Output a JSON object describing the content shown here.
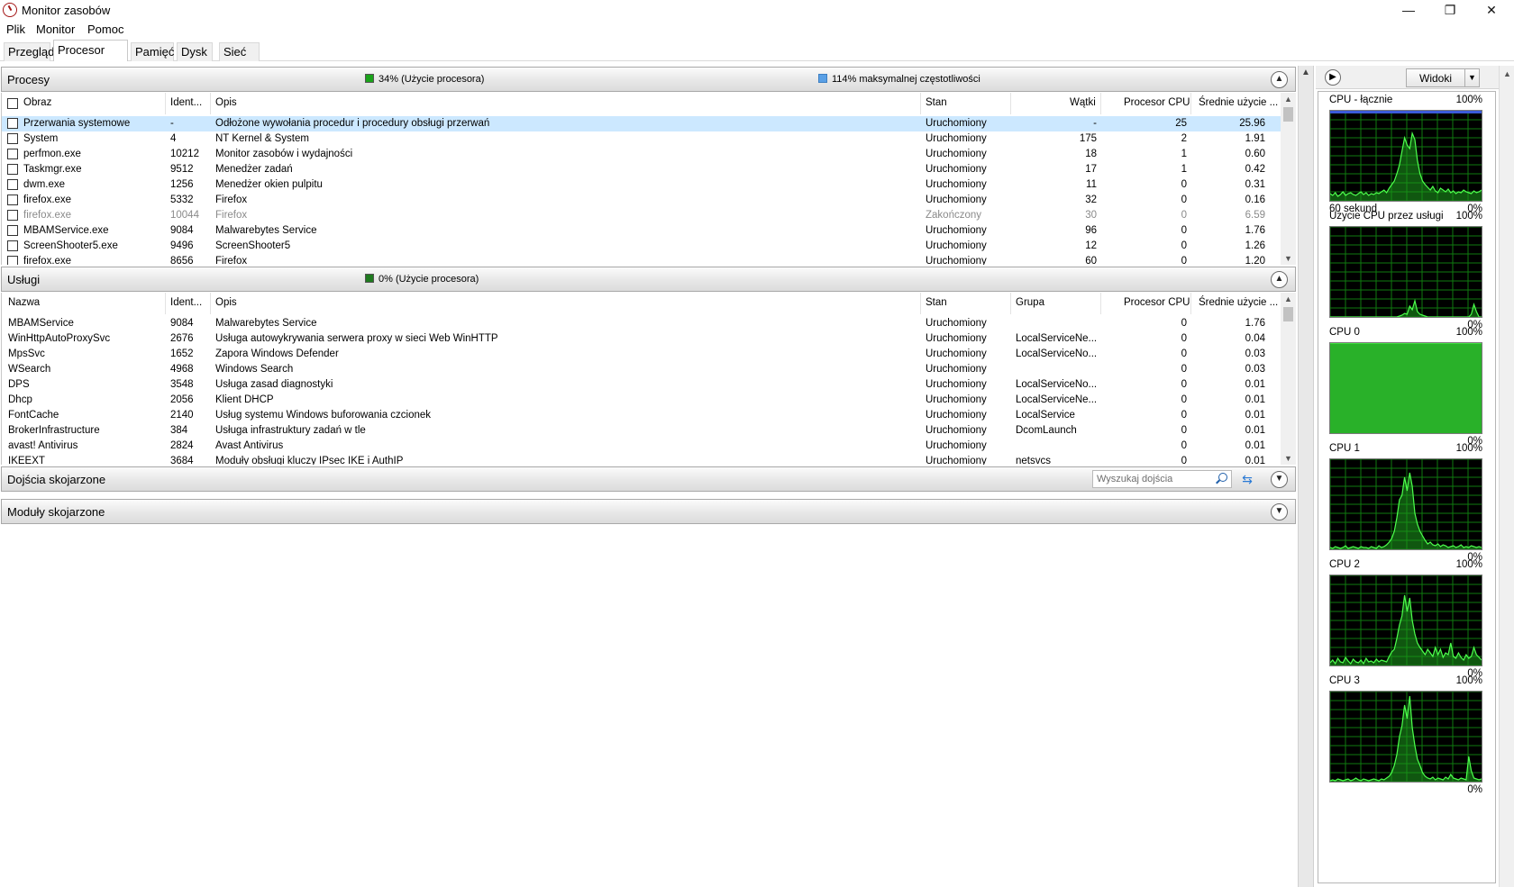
{
  "window": {
    "title": "Monitor zasobów",
    "controls": {
      "minimize": "—",
      "restore": "❐",
      "close": "✕"
    }
  },
  "menu": [
    "Plik",
    "Monitor",
    "Pomoc"
  ],
  "tabs": [
    "Przegląd",
    "Procesor CPU",
    "Pamięć",
    "Dysk",
    "Sieć"
  ],
  "active_tab": "Procesor CPU",
  "processes": {
    "title": "Procesy",
    "stat1": "34% (Użycie procesora)",
    "stat1_color": "#1aa31a",
    "stat2": "114% maksymalnej częstotliwości",
    "stat2_color": "#5aa0e6",
    "columns": [
      "Obraz",
      "Ident...",
      "Opis",
      "Stan",
      "Wątki",
      "Procesor CPU",
      "Średnie użycie ..."
    ],
    "rows": [
      {
        "name": "Przerwania systemowe",
        "pid": "-",
        "desc": "Odłożone wywołania procedur i procedury obsługi przerwań",
        "state": "Uruchomiony",
        "threads": "-",
        "cpu": "25",
        "avg": "25.96",
        "selected": true
      },
      {
        "name": "System",
        "pid": "4",
        "desc": "NT Kernel & System",
        "state": "Uruchomiony",
        "threads": "175",
        "cpu": "2",
        "avg": "1.91"
      },
      {
        "name": "perfmon.exe",
        "pid": "10212",
        "desc": "Monitor zasobów i wydajności",
        "state": "Uruchomiony",
        "threads": "18",
        "cpu": "1",
        "avg": "0.60"
      },
      {
        "name": "Taskmgr.exe",
        "pid": "9512",
        "desc": "Menedżer zadań",
        "state": "Uruchomiony",
        "threads": "17",
        "cpu": "1",
        "avg": "0.42"
      },
      {
        "name": "dwm.exe",
        "pid": "1256",
        "desc": "Menedżer okien pulpitu",
        "state": "Uruchomiony",
        "threads": "11",
        "cpu": "0",
        "avg": "0.31"
      },
      {
        "name": "firefox.exe",
        "pid": "5332",
        "desc": "Firefox",
        "state": "Uruchomiony",
        "threads": "32",
        "cpu": "0",
        "avg": "0.16"
      },
      {
        "name": "firefox.exe",
        "pid": "10044",
        "desc": "Firefox",
        "state": "Zakończony",
        "threads": "30",
        "cpu": "0",
        "avg": "6.59",
        "dim": true
      },
      {
        "name": "MBAMService.exe",
        "pid": "9084",
        "desc": "Malwarebytes Service",
        "state": "Uruchomiony",
        "threads": "96",
        "cpu": "0",
        "avg": "1.76"
      },
      {
        "name": "ScreenShooter5.exe",
        "pid": "9496",
        "desc": "ScreenShooter5",
        "state": "Uruchomiony",
        "threads": "12",
        "cpu": "0",
        "avg": "1.26"
      },
      {
        "name": "firefox.exe",
        "pid": "8656",
        "desc": "Firefox",
        "state": "Uruchomiony",
        "threads": "60",
        "cpu": "0",
        "avg": "1.20"
      }
    ]
  },
  "services": {
    "title": "Usługi",
    "stat1": "0% (Użycie procesora)",
    "stat1_color": "#1f7a1f",
    "columns": [
      "Nazwa",
      "Ident...",
      "Opis",
      "Stan",
      "Grupa",
      "Procesor CPU",
      "Średnie użycie ..."
    ],
    "rows": [
      {
        "name": "MBAMService",
        "pid": "9084",
        "desc": "Malwarebytes Service",
        "state": "Uruchomiony",
        "group": "",
        "cpu": "0",
        "avg": "1.76"
      },
      {
        "name": "WinHttpAutoProxySvc",
        "pid": "2676",
        "desc": "Usługa autowykrywania serwera proxy w sieci Web WinHTTP",
        "state": "Uruchomiony",
        "group": "LocalServiceNe...",
        "cpu": "0",
        "avg": "0.04"
      },
      {
        "name": "MpsSvc",
        "pid": "1652",
        "desc": "Zapora Windows Defender",
        "state": "Uruchomiony",
        "group": "LocalServiceNo...",
        "cpu": "0",
        "avg": "0.03"
      },
      {
        "name": "WSearch",
        "pid": "4968",
        "desc": "Windows Search",
        "state": "Uruchomiony",
        "group": "",
        "cpu": "0",
        "avg": "0.03"
      },
      {
        "name": "DPS",
        "pid": "3548",
        "desc": "Usługa zasad diagnostyki",
        "state": "Uruchomiony",
        "group": "LocalServiceNo...",
        "cpu": "0",
        "avg": "0.01"
      },
      {
        "name": "Dhcp",
        "pid": "2056",
        "desc": "Klient DHCP",
        "state": "Uruchomiony",
        "group": "LocalServiceNe...",
        "cpu": "0",
        "avg": "0.01"
      },
      {
        "name": "FontCache",
        "pid": "2140",
        "desc": "Usług systemu Windows buforowania czcionek",
        "state": "Uruchomiony",
        "group": "LocalService",
        "cpu": "0",
        "avg": "0.01"
      },
      {
        "name": "BrokerInfrastructure",
        "pid": "384",
        "desc": "Usługa infrastruktury zadań w tle",
        "state": "Uruchomiony",
        "group": "DcomLaunch",
        "cpu": "0",
        "avg": "0.01"
      },
      {
        "name": "avast! Antivirus",
        "pid": "2824",
        "desc": "Avast Antivirus",
        "state": "Uruchomiony",
        "group": "",
        "cpu": "0",
        "avg": "0.01"
      },
      {
        "name": "IKEEXT",
        "pid": "3684",
        "desc": "Moduły obsługi kluczy IPsec IKE i AuthIP",
        "state": "Uruchomiony",
        "group": "netsvcs",
        "cpu": "0",
        "avg": "0.01"
      }
    ]
  },
  "handles": {
    "title": "Dojścia skojarzone",
    "search_placeholder": "Wyszukaj dojścia"
  },
  "modules": {
    "title": "Moduły skojarzone"
  },
  "right_pane": {
    "views_label": "Widoki",
    "graphs": [
      {
        "label": "CPU - łącznie",
        "max": "100%",
        "foot_left": "60 sekund",
        "foot_right": "0%"
      },
      {
        "label": "Użycie CPU przez usługi",
        "max": "100%",
        "foot_left": "",
        "foot_right": "0%"
      },
      {
        "label": "CPU 0",
        "max": "100%",
        "foot_left": "",
        "foot_right": "0%"
      },
      {
        "label": "CPU 1",
        "max": "100%",
        "foot_left": "",
        "foot_right": "0%"
      },
      {
        "label": "CPU 2",
        "max": "100%",
        "foot_left": "",
        "foot_right": "0%"
      },
      {
        "label": "CPU 3",
        "max": "100%",
        "foot_left": "",
        "foot_right": "0%"
      }
    ]
  }
}
